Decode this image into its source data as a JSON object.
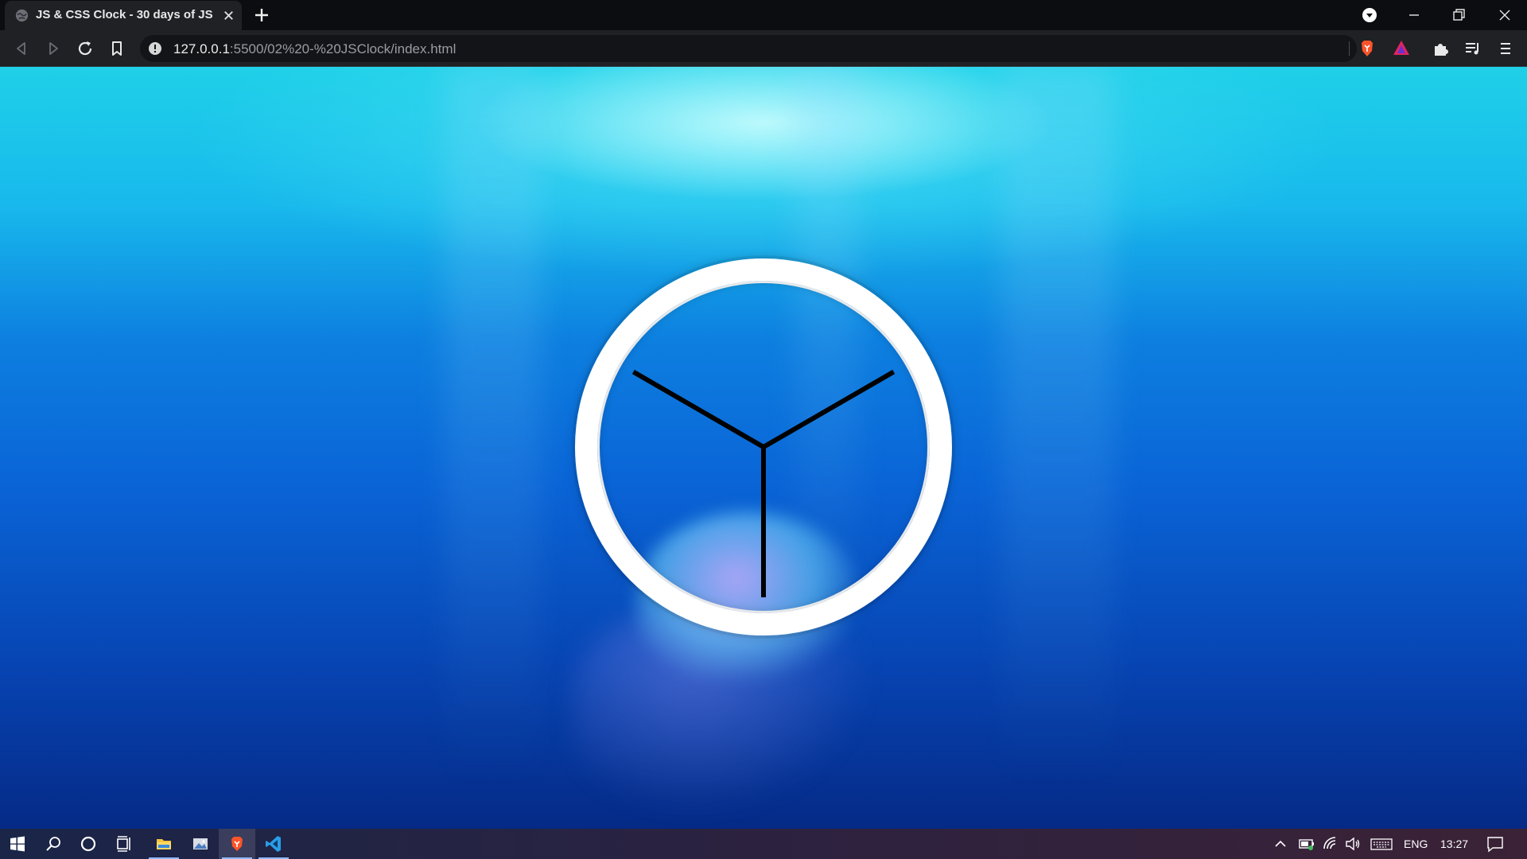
{
  "browser": {
    "tab_title": "JS & CSS Clock - 30 days of JS",
    "url_host": "127.0.0.1",
    "url_path": ":5500/02%20-%20JSClock/index.html",
    "icons": [
      "globe-icon",
      "close-icon",
      "plus-icon",
      "back-icon",
      "forward-icon",
      "reload-icon",
      "bookmark-icon",
      "info-icon",
      "brave-shield-icon",
      "brave-rewards-icon",
      "extensions-icon",
      "playlist-icon",
      "menu-icon",
      "minimize-icon",
      "restore-icon",
      "window-close-icon",
      "profile-dropdown-icon"
    ]
  },
  "clock": {
    "hands": [
      {
        "name": "hour-hand",
        "angle_deg": 30
      },
      {
        "name": "minute-hand",
        "angle_deg": 150
      },
      {
        "name": "second-hand",
        "angle_deg": 270
      }
    ],
    "colors": {
      "face_border": "#ffffff",
      "hands": "#000000"
    }
  },
  "taskbar": {
    "language": "ENG",
    "time": "13:27",
    "icons": [
      "windows-start-icon",
      "search-icon",
      "cortana-icon",
      "task-view-icon",
      "file-explorer-icon",
      "photos-icon",
      "brave-icon",
      "vscode-icon",
      "chevron-up-icon",
      "battery-icon",
      "wifi-icon",
      "volume-icon",
      "keyboard-icon",
      "notification-icon"
    ]
  }
}
